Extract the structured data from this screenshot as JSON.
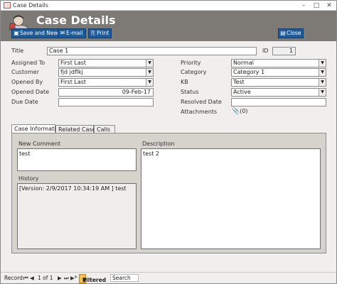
{
  "window": {
    "title": "Case Details",
    "minimize_icon": "minimize-icon",
    "maximize_icon": "maximize-icon",
    "close_icon": "close-icon"
  },
  "header": {
    "title": "Case Details",
    "buttons": {
      "save_new": "Save and New",
      "email": "E-mail",
      "print": "Print",
      "close": "Close"
    }
  },
  "form": {
    "title_label": "Title",
    "title_value": "Case 1",
    "id_label": "ID",
    "id_value": "1",
    "assigned_to_label": "Assigned To",
    "assigned_to_value": "First Last",
    "customer_label": "Customer",
    "customer_value": "fjd jdflkj",
    "opened_by_label": "Opened By",
    "opened_by_value": "First Last",
    "opened_date_label": "Opened Date",
    "opened_date_value": "09-Feb-17",
    "due_date_label": "Due Date",
    "due_date_value": "",
    "priority_label": "Priority",
    "priority_value": "Normal",
    "category_label": "Category",
    "category_value": "Category 1",
    "kb_label": "KB",
    "kb_value": "Test",
    "status_label": "Status",
    "status_value": "Active",
    "resolved_date_label": "Resolved Date",
    "resolved_date_value": "",
    "attachments_label": "Attachments",
    "attachments_value": "(0)"
  },
  "tabs": [
    {
      "label": "Case Information"
    },
    {
      "label": "Related Cases"
    },
    {
      "label": "Calls"
    }
  ],
  "case_info": {
    "new_comment_label": "New Comment",
    "new_comment_value": "test",
    "history_label": "History",
    "history_value": "[Version:  2/9/2017 10:34:19 AM ] test",
    "description_label": "Description",
    "description_value": "test 2"
  },
  "statusbar": {
    "record_label": "Record:",
    "position": "1 of 1",
    "filtered": "Filtered",
    "search": "Search"
  },
  "colors": {
    "header_bg": "#7d7a76",
    "button_bg": "#1c5a9a",
    "filtered_bg": "#f2c14e"
  }
}
